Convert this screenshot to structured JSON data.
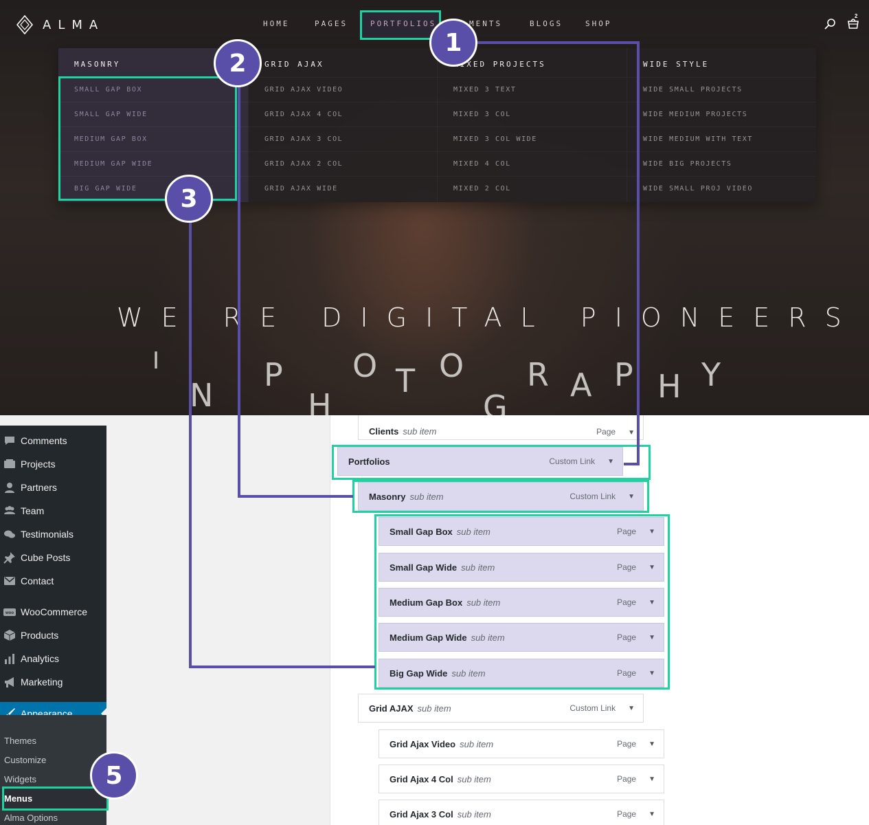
{
  "site": {
    "logo_text": "ALMA",
    "nav": [
      {
        "label": "HOME"
      },
      {
        "label": "PAGES"
      },
      {
        "label": "PORTFOLIOS"
      },
      {
        "label": "MENTS"
      },
      {
        "label": "BLOGS"
      },
      {
        "label": "SHOP"
      }
    ],
    "cart_count": "2",
    "mega": [
      {
        "heading": "MASONRY",
        "items": [
          "SMALL GAP BOX",
          "SMALL GAP WIDE",
          "MEDIUM GAP BOX",
          "MEDIUM GAP WIDE",
          "BIG GAP WIDE"
        ]
      },
      {
        "heading": "GRID AJAX",
        "items": [
          "GRID AJAX VIDEO",
          "GRID AJAX 4 COL",
          "GRID AJAX 3 COL",
          "GRID AJAX 2 COL",
          "GRID AJAX WIDE"
        ]
      },
      {
        "heading": "MIXED PROJECTS",
        "items": [
          "MIXED 3 TEXT",
          "MIXED 3 COL",
          "MIXED 3 COL WIDE",
          "MIXED 4 COL",
          "MIXED 2 COL"
        ]
      },
      {
        "heading": "WIDE STYLE",
        "items": [
          "WIDE SMALL PROJECTS",
          "WIDE MEDIUM PROJECTS",
          "WIDE MEDIUM WITH TEXT",
          "WIDE BIG PROJECTS",
          "WIDE SMALL PROJ VIDEO"
        ]
      }
    ],
    "hero_line1": "WE RE DIGITAL PIONEERS",
    "hero_line2_letters": [
      "I",
      "N",
      "P",
      "H",
      "O",
      "T",
      "O",
      "G",
      "R",
      "A",
      "P",
      "H",
      "Y"
    ]
  },
  "admin": {
    "sidebar": [
      {
        "label": "Comments",
        "icon": "comment-icon"
      },
      {
        "label": "Projects",
        "icon": "projects-icon"
      },
      {
        "label": "Partners",
        "icon": "partner-icon"
      },
      {
        "label": "Team",
        "icon": "team-icon"
      },
      {
        "label": "Testimonials",
        "icon": "testimonials-icon"
      },
      {
        "label": "Cube Posts",
        "icon": "pin-icon"
      },
      {
        "label": "Contact",
        "icon": "mail-icon"
      },
      {
        "label": "WooCommerce",
        "icon": "woo-icon"
      },
      {
        "label": "Products",
        "icon": "products-icon"
      },
      {
        "label": "Analytics",
        "icon": "analytics-icon"
      },
      {
        "label": "Marketing",
        "icon": "megaphone-icon"
      },
      {
        "label": "Appearance",
        "icon": "brush-icon"
      }
    ],
    "submenu": [
      "Themes",
      "Customize",
      "Widgets",
      "Menus",
      "Alma Options"
    ],
    "menu_items": [
      {
        "title": "Clients",
        "sub": "sub item",
        "kind": "Page"
      },
      {
        "title": "Portfolios",
        "sub": "",
        "kind": "Custom Link"
      },
      {
        "title": "Masonry",
        "sub": "sub item",
        "kind": "Custom Link"
      },
      {
        "title": "Small Gap Box",
        "sub": "sub item",
        "kind": "Page"
      },
      {
        "title": "Small Gap Wide",
        "sub": "sub item",
        "kind": "Page"
      },
      {
        "title": "Medium Gap Box",
        "sub": "sub item",
        "kind": "Page"
      },
      {
        "title": "Medium Gap Wide",
        "sub": "sub item",
        "kind": "Page"
      },
      {
        "title": "Big Gap Wide",
        "sub": "sub item",
        "kind": "Page"
      },
      {
        "title": "Grid AJAX",
        "sub": "sub item",
        "kind": "Custom Link"
      },
      {
        "title": "Grid Ajax Video",
        "sub": "sub item",
        "kind": "Page"
      },
      {
        "title": "Grid Ajax 4 Col",
        "sub": "sub item",
        "kind": "Page"
      },
      {
        "title": "Grid Ajax 3 Col",
        "sub": "sub item",
        "kind": "Page"
      }
    ]
  },
  "badges": [
    "1",
    "2",
    "3",
    "5"
  ],
  "colors": {
    "highlight": "#1fd3a0",
    "connector": "#5a4fa8",
    "badge": "#5a4fa8",
    "wp_active": "#0073aa"
  }
}
